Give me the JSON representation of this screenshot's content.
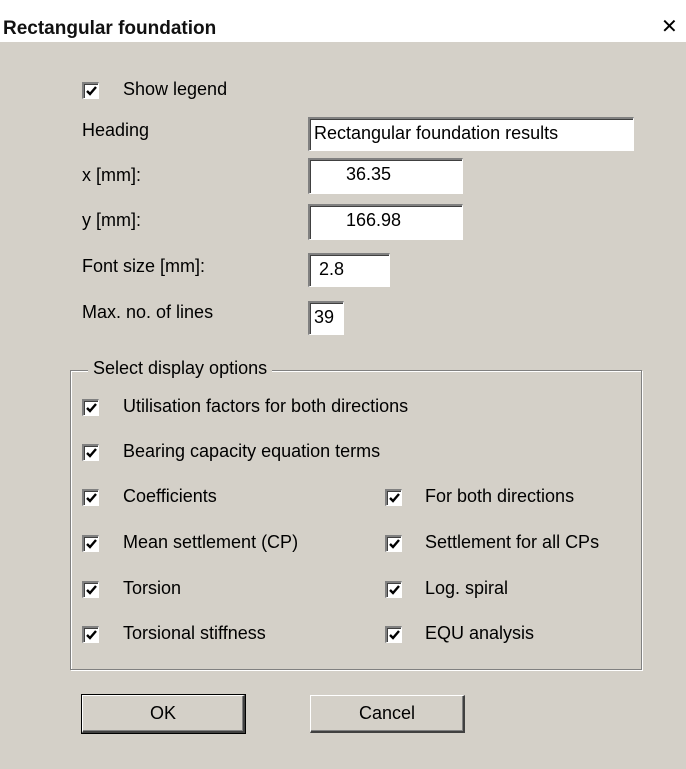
{
  "window": {
    "title": "Rectangular foundation",
    "close_glyph": "✕"
  },
  "form": {
    "show_legend": {
      "label": "Show legend",
      "checked": true
    },
    "heading": {
      "label": "Heading",
      "value": "Rectangular foundation results"
    },
    "x": {
      "label": "x [mm]:",
      "value": "36.35"
    },
    "y": {
      "label": "y [mm]:",
      "value": "166.98"
    },
    "font_size": {
      "label": "Font size [mm]:",
      "value": "2.8"
    },
    "max_lines": {
      "label": "Max. no. of lines",
      "value": "39"
    }
  },
  "display_options": {
    "title": "Select display options",
    "utilisation": {
      "label": "Utilisation factors for both directions",
      "checked": true
    },
    "bearing": {
      "label": "Bearing capacity equation terms",
      "checked": true
    },
    "coefficients": {
      "label": "Coefficients",
      "checked": true
    },
    "both_directions": {
      "label": "For both directions",
      "checked": true
    },
    "mean_settlement": {
      "label": "Mean settlement (CP)",
      "checked": true
    },
    "settlement_all": {
      "label": "Settlement for all CPs",
      "checked": true
    },
    "torsion": {
      "label": "Torsion",
      "checked": true
    },
    "log_spiral": {
      "label": "Log. spiral",
      "checked": true
    },
    "torsional_stiffness": {
      "label": "Torsional stiffness",
      "checked": true
    },
    "equ_analysis": {
      "label": "EQU analysis",
      "checked": true
    }
  },
  "buttons": {
    "ok": "OK",
    "cancel": "Cancel"
  },
  "icons": {
    "checkmark": "check-icon",
    "close": "close-icon"
  }
}
